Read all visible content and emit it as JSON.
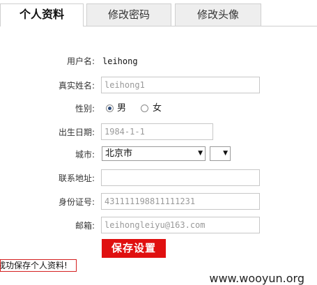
{
  "tabs": [
    {
      "label": "个人资料",
      "active": true
    },
    {
      "label": "修改密码",
      "active": false
    },
    {
      "label": "修改头像",
      "active": false
    }
  ],
  "form": {
    "username": {
      "label": "用户名:",
      "value": "leihong"
    },
    "realname": {
      "label": "真实姓名:",
      "value": "leihong1"
    },
    "gender": {
      "label": "性别:",
      "male": "男",
      "female": "女",
      "selected": "男"
    },
    "birthday": {
      "label": "出生日期:",
      "value": "1984-1-1"
    },
    "city": {
      "label": "城市:",
      "selected": "北京市",
      "district": ""
    },
    "address": {
      "label": "联系地址:",
      "value": ""
    },
    "idcard": {
      "label": "身份证号:",
      "value": "431111198811111231"
    },
    "email": {
      "label": "邮箱:",
      "value": "leihongleiyu@163.com"
    }
  },
  "save_button": "保存设置",
  "success_message": "成功保存个人资料!",
  "watermark": "www.wooyun.org",
  "colors": {
    "accent": "#e01010",
    "tab_inactive": "#eeeeee",
    "border": "#c7c7c7"
  }
}
